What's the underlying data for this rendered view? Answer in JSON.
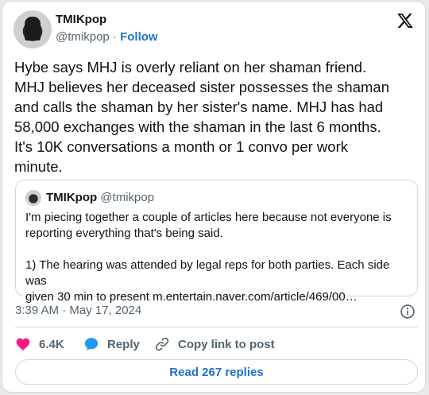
{
  "author": {
    "name": "TMIKpop",
    "handle": "@tmikpop",
    "separator": " · ",
    "follow_label": "Follow"
  },
  "tweet": {
    "text": "Hybe says MHJ is overly reliant on her shaman friend.\nMHJ believes her deceased sister possesses the shaman\nand calls the shaman by her sister's name. MHJ has had\n58,000 exchanges with the shaman in the last 6 months.\nIt's 10K conversations a month or 1 convo per work\nminute.",
    "timestamp": "3:39 AM · May 17, 2024"
  },
  "quote": {
    "name": "TMIKpop",
    "handle": "@tmikpop",
    "text": "I'm piecing together a couple of articles here because not everyone is\nreporting everything that's being said.\n\n1) The hearing was attended by legal reps for both parties. Each side was\ngiven 30 min to present m.entertain.naver.com/article/469/00…"
  },
  "actions": {
    "likes": "6.4K",
    "reply_label": "Reply",
    "copy_label": "Copy link to post"
  },
  "read_replies_label": "Read 267 replies",
  "icons": {
    "brand": "x-logo-icon",
    "info": "info-icon",
    "like": "heart-icon",
    "reply": "speech-bubble-icon",
    "copy": "link-icon"
  },
  "colors": {
    "link": "#1d72d1",
    "like": "#f91880",
    "reply": "#1d9bf0",
    "muted": "#536471"
  }
}
